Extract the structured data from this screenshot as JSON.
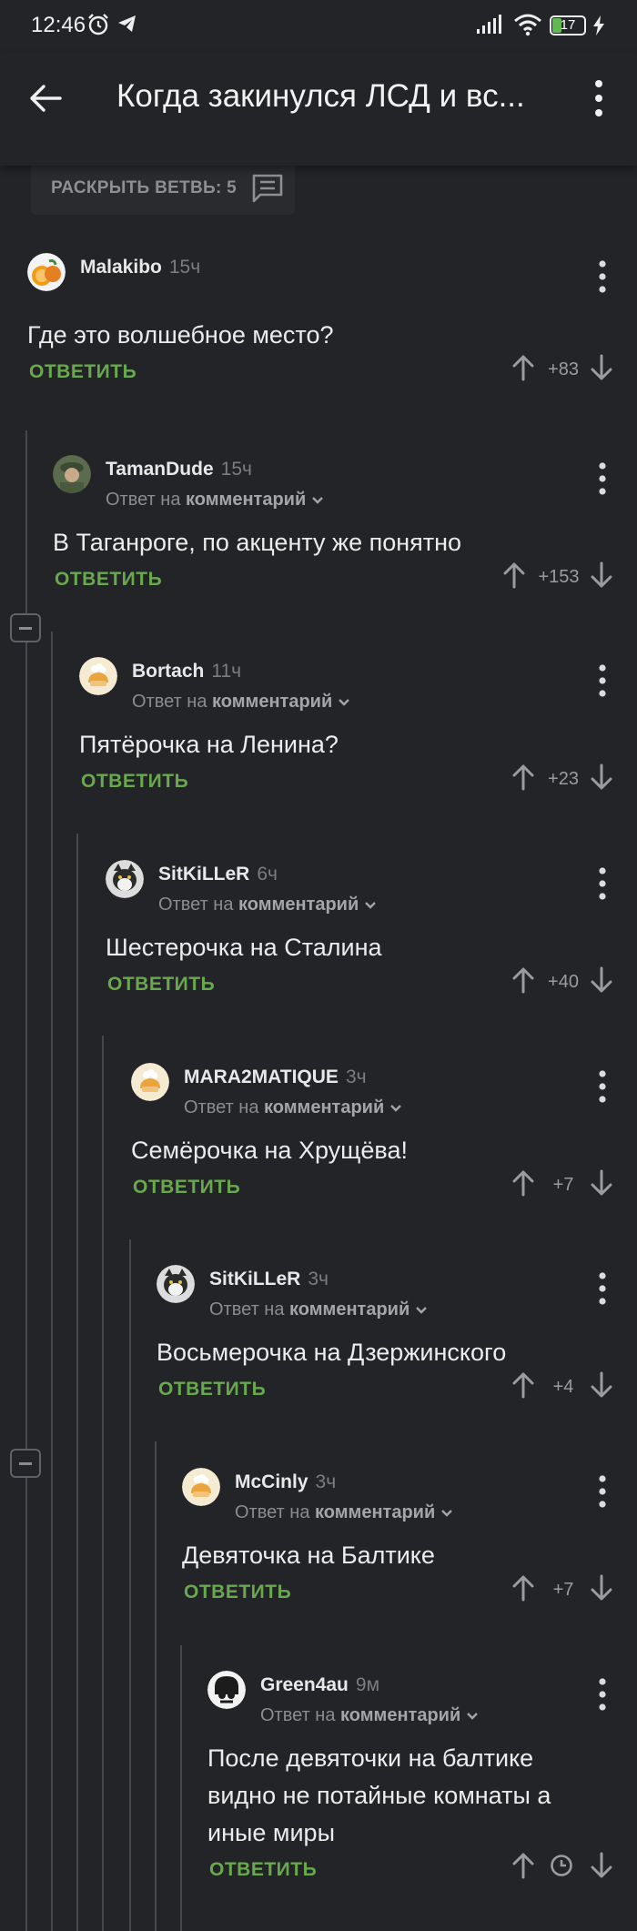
{
  "status_bar": {
    "time": "12:46",
    "battery": "17"
  },
  "header": {
    "title": "Когда закинулся ЛСД и вс..."
  },
  "expand_branch": {
    "label": "РАСКРЫТЬ ВЕТВЬ: 5"
  },
  "reply_label": "ОТВЕТИТЬ",
  "reply_prefix": "Ответ на",
  "reply_target": "комментарий",
  "comments": [
    {
      "user": "Malakibo",
      "time": "15ч",
      "text": "Где это волшебное место?",
      "score": "+83",
      "avatar": "orange"
    },
    {
      "user": "TamanDude",
      "time": "15ч",
      "text": "В Таганроге, по акценту же понятно",
      "score": "+153",
      "avatar": "soldier"
    },
    {
      "user": "Bortach",
      "time": "11ч",
      "text": "Пятёрочка на Ленина?",
      "score": "+23",
      "avatar": "default"
    },
    {
      "user": "SitKiLLeR",
      "time": "6ч",
      "text": "Шестерочка на Сталина",
      "score": "+40",
      "avatar": "cat"
    },
    {
      "user": "MARA2MATIQUE",
      "time": "3ч",
      "text": "Семёрочка на Хрущёва!",
      "score": "+7",
      "avatar": "default"
    },
    {
      "user": "SitKiLLeR",
      "time": "3ч",
      "text": "Восьмерочка на Дзержинского",
      "score": "+4",
      "avatar": "cat"
    },
    {
      "user": "McCinly",
      "time": "3ч",
      "text": "Девяточка на Балтике",
      "score": "+7",
      "avatar": "default"
    },
    {
      "user": "Green4au",
      "time": "9м",
      "text": "После девяточки на балтике видно не потайные комнаты а иные миры",
      "score": "",
      "avatar": "skull"
    }
  ]
}
